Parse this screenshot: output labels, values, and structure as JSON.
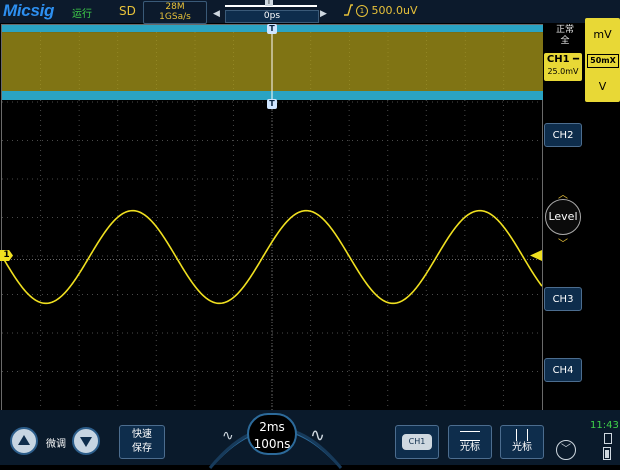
{
  "topbar": {
    "logo": "Micsig",
    "run_state": "运行",
    "acq_mode": "SD",
    "memory_depth": "28M",
    "sample_rate": "1GSa/s",
    "time_offset": "0ps",
    "trigger_level": "500.0uV",
    "trigger_slope_icon": "rising-edge-icon",
    "trigger_source_icon": "ch1-circle-icon"
  },
  "screen": {
    "trigger_marker": "T",
    "ch1_marker": "1",
    "colors": {
      "ch1": "#f0e020",
      "grid": "#555555",
      "background": "#000000"
    },
    "waveform": {
      "type": "sine",
      "period_divisions": 4.5,
      "amplitude_divisions": 2.9
    }
  },
  "right_panel": {
    "trigger_mode_line1": "正常",
    "trigger_mode_line2": "全",
    "ch1_label": "CH1",
    "ch1_scale": "25.0mV",
    "unit_top": "mV",
    "probe": "50mX",
    "unit_bottom": "V",
    "ch2": "CH2",
    "level": "Level",
    "ch3": "CH3",
    "ch4": "CH4"
  },
  "bottombar": {
    "fine_label": "微调",
    "save_line1": "快速",
    "save_line2": "保存",
    "timebase": "2ms",
    "timebase_sub": "100ns",
    "ch1_btn": "CH1",
    "cursor_h": "光标",
    "cursor_v": "光标",
    "clock": "11:43"
  }
}
